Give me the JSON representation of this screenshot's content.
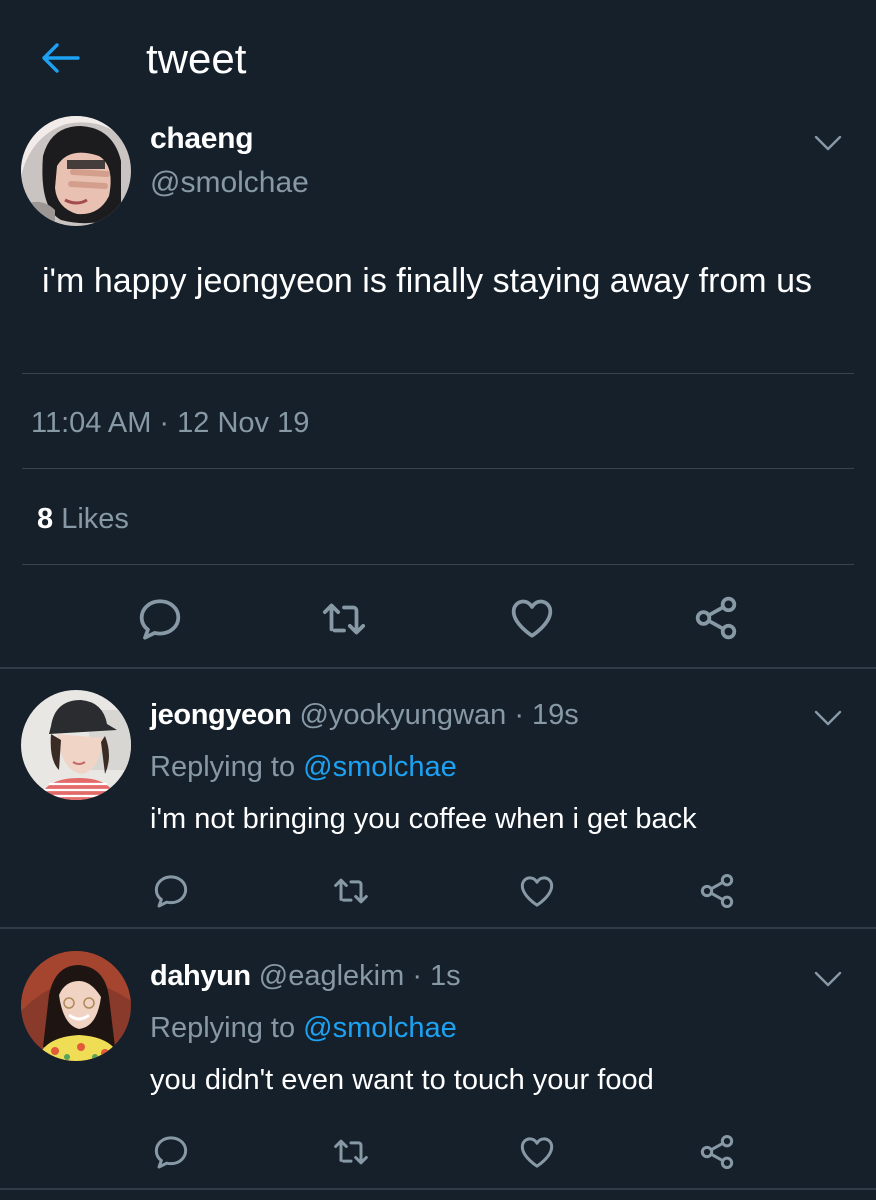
{
  "header": {
    "title": "tweet",
    "back_icon": "back-arrow-icon",
    "accent_color": "#1da1f2"
  },
  "main_tweet": {
    "name": "chaeng",
    "handle": "@smolchae",
    "text": "i'm happy jeongyeon is finally staying away from us",
    "timestamp": "11:04 AM · 12 Nov 19",
    "likes_count": "8",
    "likes_label": "Likes",
    "actions": [
      "reply-icon",
      "retweet-icon",
      "like-icon",
      "share-icon"
    ]
  },
  "replies": [
    {
      "name": "jeongyeon",
      "handle": "@yookyungwan",
      "age": "· 19s",
      "replying_label": "Replying to",
      "replying_to": "@smolchae",
      "text": "i'm not bringing you coffee when i get back"
    },
    {
      "name": "dahyun",
      "handle": "@eaglekim",
      "age": "· 1s",
      "replying_label": "Replying to",
      "replying_to": "@smolchae",
      "text": "you didn't even want to touch your food"
    }
  ],
  "colors": {
    "background": "#15202b",
    "secondary_text": "#8899a6",
    "divider": "#38444d",
    "link": "#1da1f2"
  }
}
